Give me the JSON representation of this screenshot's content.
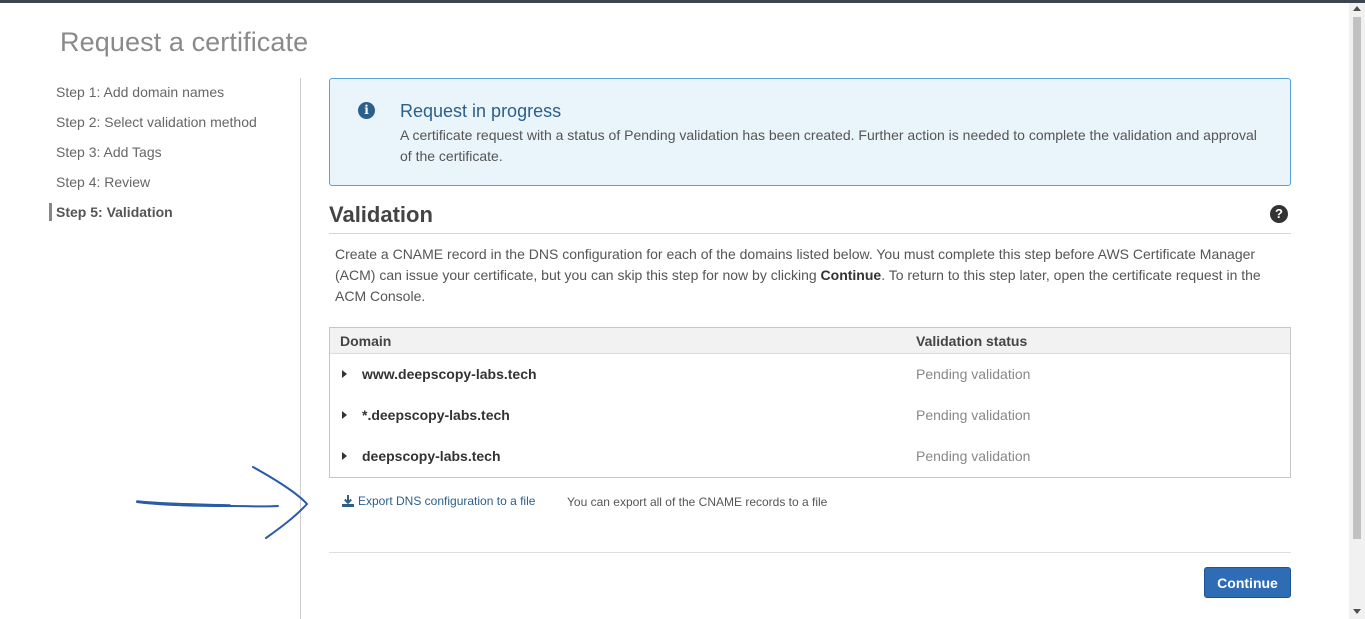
{
  "page_title": "Request a certificate",
  "steps": [
    {
      "label": "Step 1: Add domain names",
      "active": false
    },
    {
      "label": "Step 2: Select validation method",
      "active": false
    },
    {
      "label": "Step 3: Add Tags",
      "active": false
    },
    {
      "label": "Step 4: Review",
      "active": false
    },
    {
      "label": "Step 5: Validation",
      "active": true
    }
  ],
  "alert": {
    "icon": "info-icon",
    "title": "Request in progress",
    "text": "A certificate request with a status of Pending validation has been created. Further action is needed to complete the validation and approval of the certificate."
  },
  "validation": {
    "title": "Validation",
    "help_icon": "help-icon",
    "description_part1": "Create a CNAME record in the DNS configuration for each of the domains listed below. You must complete this step before AWS Certificate Manager (ACM) can issue your certificate, but you can skip this step for now by clicking ",
    "description_bold": "Continue",
    "description_part2": ". To return to this step later, open the certificate request in the ACM Console."
  },
  "table": {
    "headers": {
      "domain": "Domain",
      "status": "Validation status"
    },
    "rows": [
      {
        "domain": "www.deepscopy-labs.tech",
        "status": "Pending validation"
      },
      {
        "domain": "*.deepscopy-labs.tech",
        "status": "Pending validation"
      },
      {
        "domain": "deepscopy-labs.tech",
        "status": "Pending validation"
      }
    ]
  },
  "export": {
    "icon": "download-icon",
    "label": "Export DNS configuration to a file",
    "note": "You can export all of the CNAME records to a file"
  },
  "continue_label": "Continue",
  "colors": {
    "primary": "#2e6db5",
    "alert_bg": "#eaf4fb",
    "alert_border": "#5ba3d6",
    "link": "#2b5f8c",
    "annotation": "#2a5ba8"
  }
}
